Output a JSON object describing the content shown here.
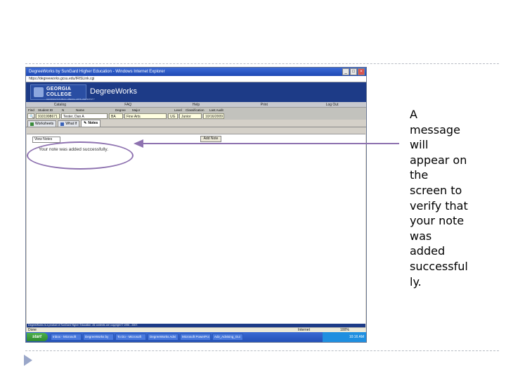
{
  "caption": {
    "lines": [
      "A",
      "message",
      "will",
      "appear on",
      "the",
      "screen to",
      "verify that",
      "your note",
      "was",
      "added",
      "successful",
      "ly."
    ]
  },
  "browser": {
    "title": "DegreeWorks by SunGard Higher Education - Windows Internet Explorer",
    "address": "https://degreeworks.gcsu.edu/IRISLink.cgi"
  },
  "app": {
    "logo_line1": "GEORGIA",
    "logo_line2": "COLLEGE",
    "logo_sub": "GEORGIA'S PUBLIC LIBERAL ARTS UNIVERSITY",
    "name": "DegreeWorks"
  },
  "menu": [
    "Catalog",
    "FAQ",
    "Help",
    "Print",
    "Log Out"
  ],
  "student": {
    "labels": {
      "find": "Find",
      "student_id": "Student ID",
      "n": "N",
      "name": "Name",
      "degree": "Degree",
      "major": "Major",
      "level": "Level",
      "classification": "Classification",
      "last_audit": "Last Audit"
    },
    "student_id": "9101998671",
    "name": "Tester, Dan A",
    "degree": "BA",
    "major": "Fine Arts",
    "level": "UG",
    "classification": "Junior",
    "last_audit": "10/16/2009"
  },
  "tabs": [
    "Worksheets",
    "What If",
    "Notes"
  ],
  "notes": {
    "view_select": "View Notes",
    "add_note_label": "Add Note",
    "success_message": "Your note was added successfully."
  },
  "footer_text": "DegreeWorks is a product of SunGard Higher Education. All contents are copyright © 1996 - 2007.",
  "status": {
    "left": "Done",
    "zone": "Internet",
    "zoom": "100%"
  },
  "taskbar": {
    "start": "start",
    "tasks": [
      "Inbox - Microsoft",
      "DegreeWorks by",
      "To Do - Microsoft",
      "DegreeWorks Advi",
      "Microsoft PowerPoi",
      "Adv_Advising_Gui"
    ],
    "clock": "10:16 AM"
  },
  "colors": {
    "header_navy": "#1d3b87",
    "ellipse_purple": "#8e72b0",
    "field_yellow": "#ffffe0",
    "bullet_blue": "#9aa7c9"
  }
}
